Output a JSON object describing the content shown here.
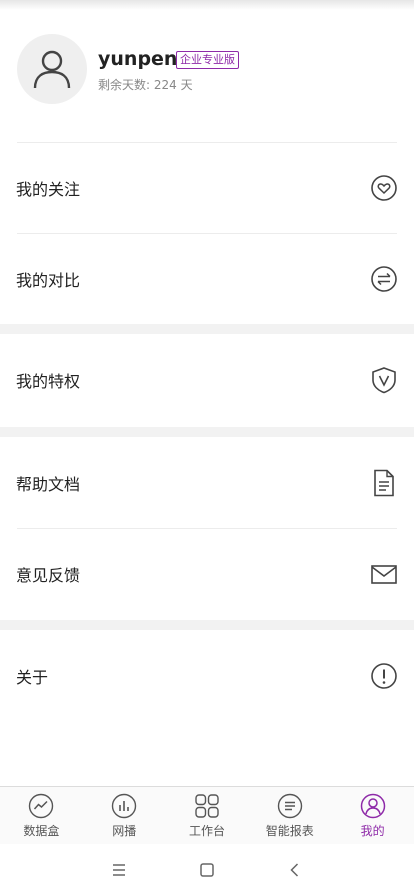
{
  "profile": {
    "username": "yunpeng",
    "badge": "企业专业版",
    "days_label": "剩余天数",
    "days_value": "224 天"
  },
  "menu": [
    {
      "label": "我的关注",
      "icon": "heart-icon"
    },
    {
      "label": "我的对比",
      "icon": "swap-icon"
    },
    {
      "label": "我的特权",
      "icon": "shield-v-icon"
    },
    {
      "label": "帮助文档",
      "icon": "document-icon"
    },
    {
      "label": "意见反馈",
      "icon": "mail-icon"
    },
    {
      "label": "关于",
      "icon": "info-icon"
    }
  ],
  "tabs": [
    {
      "label": "数据盒",
      "icon": "trend-icon",
      "active": false
    },
    {
      "label": "网播",
      "icon": "bar-chart-icon",
      "active": false
    },
    {
      "label": "工作台",
      "icon": "grid-icon",
      "active": false
    },
    {
      "label": "智能报表",
      "icon": "list-icon",
      "active": false
    },
    {
      "label": "我的",
      "icon": "user-icon",
      "active": true
    }
  ],
  "colors": {
    "accent": "#8e2aa8",
    "text": "#222222",
    "muted": "#888888",
    "separator": "#f2f2f2"
  }
}
